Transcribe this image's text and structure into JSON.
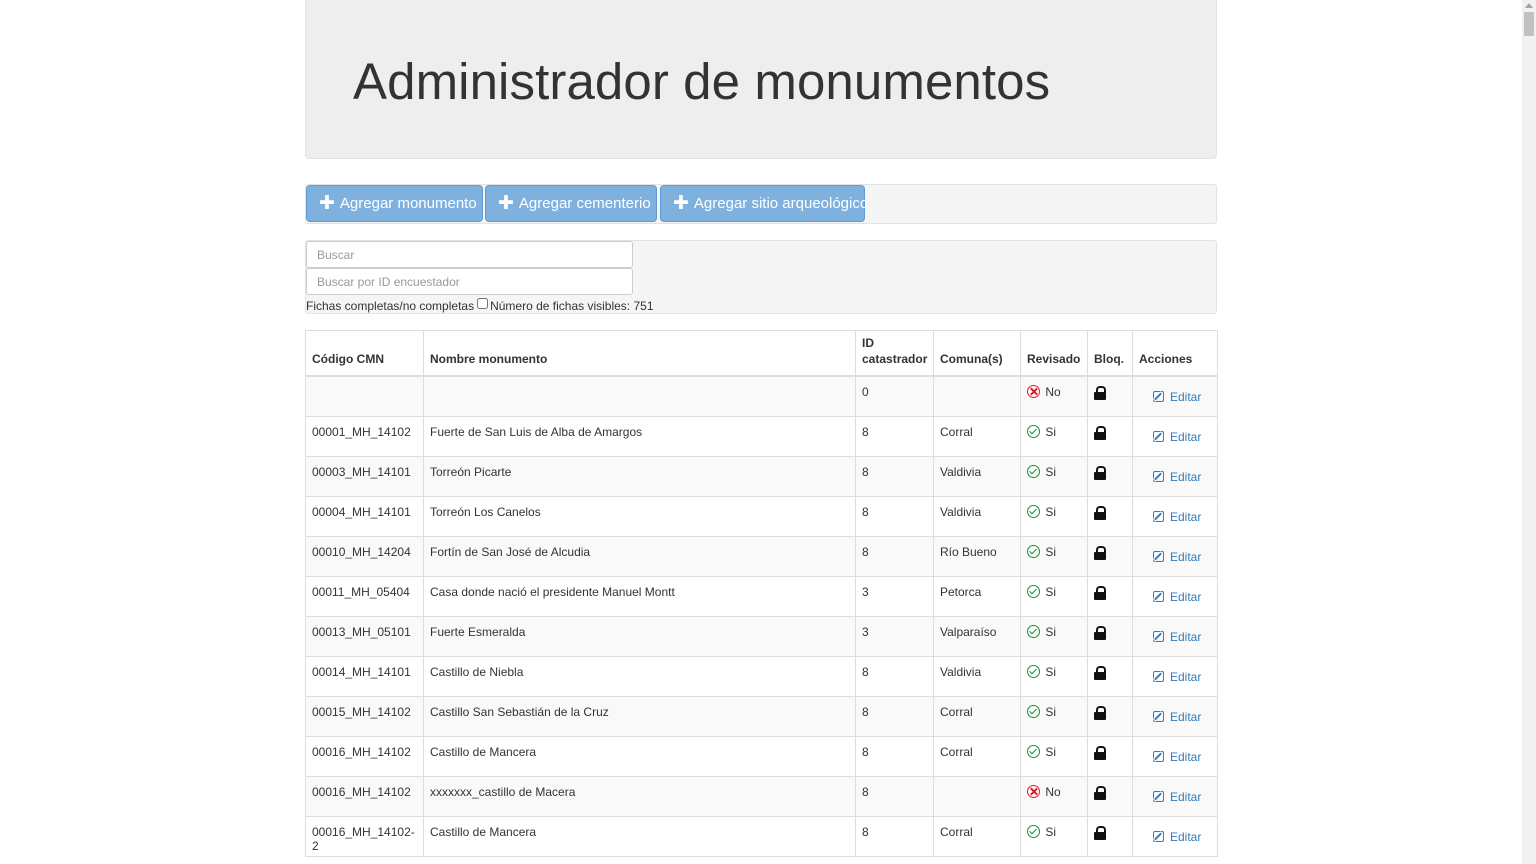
{
  "header": {
    "title": "Administrador de monumentos"
  },
  "toolbar": {
    "add_monument": "Agregar monumento",
    "add_cemetery": "Agregar cementerio",
    "add_archaeological_site": "Agregar sitio arqueológico"
  },
  "search": {
    "placeholder": "Buscar",
    "id_placeholder": "Buscar por ID encuestador",
    "complete_filter_label": "Fichas completas/no completas",
    "visible_count_label": "Número de fichas visibles: 751"
  },
  "table": {
    "headers": {
      "code": "Código CMN",
      "name": "Nombre monumento",
      "id": "ID catastrador",
      "commune": "Comuna(s)",
      "reviewed": "Revisado",
      "locked": "Bloq.",
      "actions": "Acciones"
    },
    "edit_label": "Editar",
    "rows": [
      {
        "code": "",
        "name": "",
        "id": "0",
        "commune": "",
        "reviewed": "No",
        "reviewed_ok": false
      },
      {
        "code": "00001_MH_14102",
        "name": "Fuerte de San Luis de Alba de Amargos",
        "id": "8",
        "commune": "Corral",
        "reviewed": "Si",
        "reviewed_ok": true
      },
      {
        "code": "00003_MH_14101",
        "name": "Torreón Picarte",
        "id": "8",
        "commune": "Valdivia",
        "reviewed": "Si",
        "reviewed_ok": true
      },
      {
        "code": "00004_MH_14101",
        "name": "Torreón Los Canelos",
        "id": "8",
        "commune": "Valdivia",
        "reviewed": "Si",
        "reviewed_ok": true
      },
      {
        "code": "00010_MH_14204",
        "name": "Fortín de San José de Alcudia",
        "id": "8",
        "commune": "Río Bueno",
        "reviewed": "Si",
        "reviewed_ok": true
      },
      {
        "code": "00011_MH_05404",
        "name": "Casa donde nació el presidente Manuel Montt",
        "id": "3",
        "commune": "Petorca",
        "reviewed": "Si",
        "reviewed_ok": true
      },
      {
        "code": "00013_MH_05101",
        "name": "Fuerte Esmeralda",
        "id": "3",
        "commune": "Valparaíso",
        "reviewed": "Si",
        "reviewed_ok": true
      },
      {
        "code": "00014_MH_14101",
        "name": "Castillo de Niebla",
        "id": "8",
        "commune": "Valdivia",
        "reviewed": "Si",
        "reviewed_ok": true
      },
      {
        "code": "00015_MH_14102",
        "name": "Castillo San Sebastián de la Cruz",
        "id": "8",
        "commune": "Corral",
        "reviewed": "Si",
        "reviewed_ok": true
      },
      {
        "code": "00016_MH_14102",
        "name": "Castillo de Mancera",
        "id": "8",
        "commune": "Corral",
        "reviewed": "Si",
        "reviewed_ok": true
      },
      {
        "code": "00016_MH_14102",
        "name": "xxxxxxx_castillo de Macera",
        "id": "8",
        "commune": "",
        "reviewed": "No",
        "reviewed_ok": false
      },
      {
        "code": "00016_MH_14102-2",
        "name": "Castillo de Mancera",
        "id": "8",
        "commune": "Corral",
        "reviewed": "Si",
        "reviewed_ok": true
      }
    ]
  },
  "colors": {
    "button": "#7fb1de",
    "ok": "#1e8c3a",
    "no": "#d21f2a",
    "link": "#337ab7"
  },
  "icons": [
    "plus-icon",
    "check-circle-icon",
    "x-circle-icon",
    "lock-icon",
    "edit-icon"
  ]
}
